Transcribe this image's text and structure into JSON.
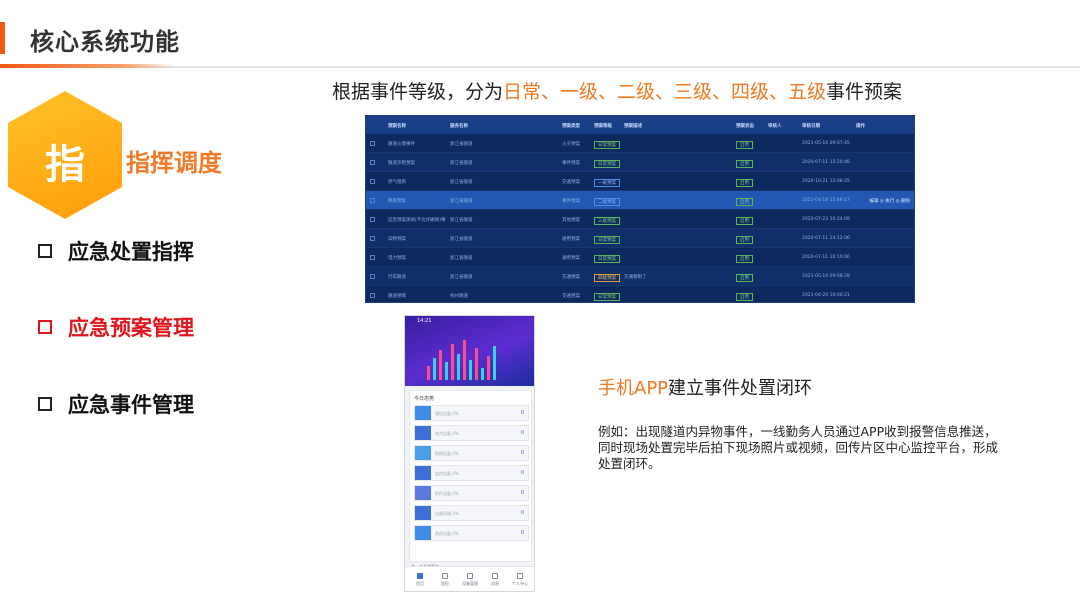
{
  "header": {
    "title": "核心系统功能"
  },
  "badge": {
    "char": "指",
    "label": "指挥调度"
  },
  "menu": [
    {
      "label": "应急处置指挥",
      "active": false
    },
    {
      "label": "应急预案管理",
      "active": true
    },
    {
      "label": "应急事件管理",
      "active": false
    }
  ],
  "heading": {
    "prefix": "根据事件等级，分为",
    "levels": "日常、一级、二级、三级、四级、五级",
    "suffix": "事件预案"
  },
  "table": {
    "columns": [
      "预案名称",
      "服务名称",
      "预案类型",
      "预案等级",
      "预案描述",
      "预案状态",
      "审核人",
      "审核日期",
      "操作"
    ],
    "rows": [
      {
        "name": "隧道火情事件",
        "service": "浙江省隧道",
        "type": "火灾预案",
        "level": "日常预案",
        "level_color": "green",
        "desc": "",
        "status": "启用",
        "date": "2021-05-16 09:07:45"
      },
      {
        "name": "隧道涉稳预案",
        "service": "浙江省隧道",
        "type": "事件预案",
        "level": "日常预案",
        "level_color": "green",
        "desc": "",
        "status": "启用",
        "date": "2020-07-11 15:20:46"
      },
      {
        "name": "停气阻断",
        "service": "浙江省隧道",
        "type": "交通预案",
        "level": "一级预案",
        "level_color": "blue",
        "desc": "",
        "status": "启用",
        "date": "2020-10-21 12:08:25"
      },
      {
        "name": "降雨预案",
        "service": "浙江省隧道",
        "type": "事件预案",
        "level": "二级预案",
        "level_color": "blue",
        "desc": "",
        "status": "启用",
        "date": "2021-04-19 15:46:17"
      },
      {
        "name": "应急预案测试(不允许删除)事件",
        "service": "浙江省隧道",
        "type": "其他预案",
        "level": "三级预案",
        "level_color": "green",
        "desc": "",
        "status": "启用",
        "date": "2020-07-23 10:24:09"
      },
      {
        "name": "异物预案",
        "service": "浙江省隧道",
        "type": "通用预案",
        "level": "日常预案",
        "level_color": "green",
        "desc": "",
        "status": "启用",
        "date": "2020-07-11 14:12:06"
      },
      {
        "name": "电力预案",
        "service": "浙江省隧道",
        "type": "通用预案",
        "level": "日常预案",
        "level_color": "green",
        "desc": "",
        "status": "启用",
        "date": "2020-07-11 10:10:06"
      },
      {
        "name": "行车隧道",
        "service": "浙江省隧道",
        "type": "交通预案",
        "level": "四级预案",
        "level_color": "orange",
        "desc": "交通管制了",
        "status": "启用",
        "date": "2021-05-16 09:08:28"
      },
      {
        "name": "隧道保障",
        "service": "杭州隧道",
        "type": "交通预案",
        "level": "日常预案",
        "level_color": "green",
        "desc": "",
        "status": "启用",
        "date": "2021-04-20 10:00:21"
      }
    ],
    "row_actions": "编辑 ◎ 执行 ◎ 删除"
  },
  "phone": {
    "time": "14:21",
    "card_title": "今日态势",
    "rows": [
      {
        "label": "通信设备 0%",
        "value": "0"
      },
      {
        "label": "电力设备 0%",
        "value": "0"
      },
      {
        "label": "网络设备 0%",
        "value": "0"
      },
      {
        "label": "监控设备 0%",
        "value": "0"
      },
      {
        "label": "附件设备 0%",
        "value": "0"
      },
      {
        "label": "设备设施 0%",
        "value": "0"
      },
      {
        "label": "其他设备 0%",
        "value": "0"
      }
    ],
    "bottom_label": "选一个系统版本",
    "tabs": [
      "首页",
      "巡检",
      "设备管理",
      "消息",
      "个人中心"
    ]
  },
  "app": {
    "title_highlight": "手机APP",
    "title_rest": "建立事件处置闭环",
    "description": "例如：出现隧道内异物事件，一线勤务人员通过APP收到报警信息推送，同时现场处置完毕后拍下现场照片或视频，回传片区中心监控平台，形成处置闭环。"
  }
}
